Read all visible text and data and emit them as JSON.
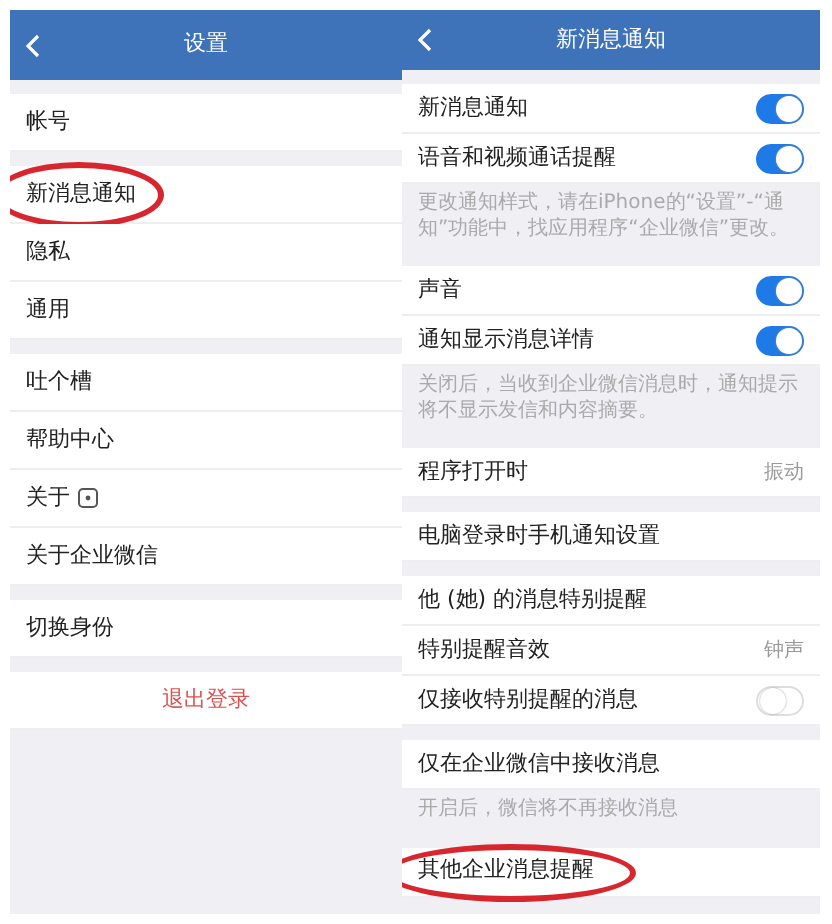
{
  "screens": [
    {
      "title": "设置",
      "sections": [
        {
          "items": [
            {
              "kind": "link",
              "label": "帐号"
            }
          ]
        },
        {
          "items": [
            {
              "kind": "link",
              "label": "新消息通知",
              "circled": true
            },
            {
              "kind": "link",
              "label": "隐私"
            },
            {
              "kind": "link",
              "label": "通用"
            }
          ]
        },
        {
          "items": [
            {
              "kind": "link",
              "label": "吐个槽"
            },
            {
              "kind": "link",
              "label": "帮助中心"
            },
            {
              "kind": "link-icon",
              "label": "关于"
            },
            {
              "kind": "link",
              "label": "关于企业微信"
            }
          ]
        },
        {
          "items": [
            {
              "kind": "link",
              "label": "切换身份"
            }
          ]
        },
        {
          "items": [
            {
              "kind": "action",
              "label": "退出登录"
            }
          ]
        }
      ]
    },
    {
      "title": "新消息通知",
      "sections": [
        {
          "items": [
            {
              "kind": "toggle",
              "label": "新消息通知",
              "on": true
            },
            {
              "kind": "toggle",
              "label": "语音和视频通话提醒",
              "on": true
            }
          ],
          "note": "更改通知样式，请在iPhone的“设置”-“通知”功能中，找应用程序“企业微信”更改。"
        },
        {
          "items": [
            {
              "kind": "toggle",
              "label": "声音",
              "on": true
            },
            {
              "kind": "toggle",
              "label": "通知显示消息详情",
              "on": true
            }
          ],
          "note": "关闭后，当收到企业微信消息时，通知提示将不显示发信和内容摘要。"
        },
        {
          "items": [
            {
              "kind": "value",
              "label": "程序打开时",
              "value": "振动"
            }
          ]
        },
        {
          "items": [
            {
              "kind": "link",
              "label": "电脑登录时手机通知设置"
            }
          ]
        },
        {
          "items": [
            {
              "kind": "link",
              "label": "他 (她) 的消息特别提醒"
            },
            {
              "kind": "value",
              "label": "特别提醒音效",
              "value": "钟声"
            },
            {
              "kind": "toggle",
              "label": "仅接收特别提醒的消息",
              "on": false
            }
          ]
        },
        {
          "items": [
            {
              "kind": "link",
              "label": "仅在企业微信中接收消息"
            }
          ],
          "note": "开启后，微信将不再接收消息"
        },
        {
          "items": [
            {
              "kind": "link",
              "label": "其他企业消息提醒",
              "circled": true
            }
          ]
        }
      ]
    }
  ]
}
